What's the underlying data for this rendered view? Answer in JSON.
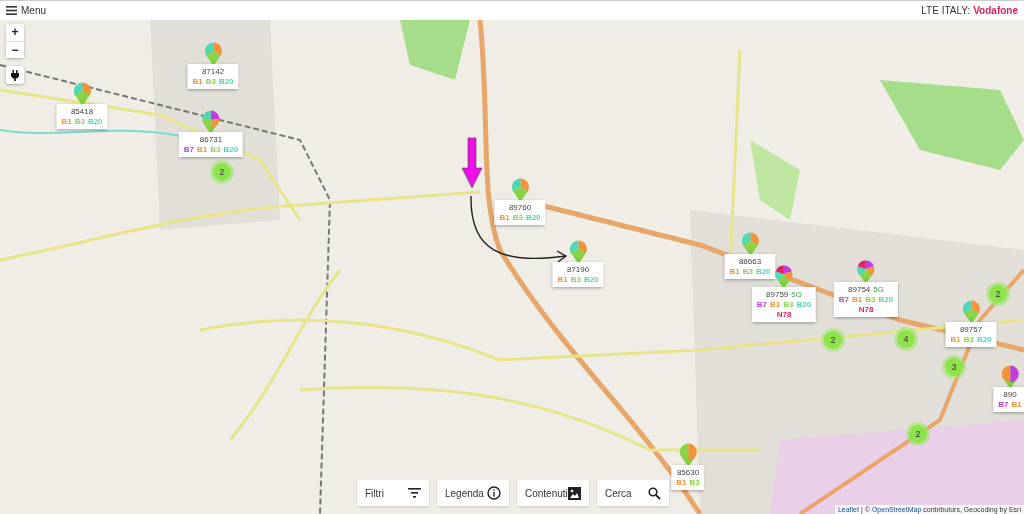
{
  "header": {
    "menu_label": "Menu",
    "title": "LTE ITALY:",
    "operator": "Vodafone"
  },
  "zoom_controls": [
    "+",
    "−"
  ],
  "markers": [
    {
      "id": "87142",
      "bands": [
        {
          "label": "B1",
          "color": "#f0943a"
        },
        {
          "label": "B3",
          "color": "#8bd44a"
        },
        {
          "label": "B20",
          "color": "#4fd8b4"
        }
      ]
    },
    {
      "id": "85418",
      "bands": [
        {
          "label": "B1",
          "color": "#f0943a"
        },
        {
          "label": "B3",
          "color": "#8bd44a"
        },
        {
          "label": "B20",
          "color": "#4fd8b4"
        }
      ]
    },
    {
      "id": "86731",
      "bands": [
        {
          "label": "B7",
          "color": "#c23de0"
        },
        {
          "label": "B1",
          "color": "#f0943a"
        },
        {
          "label": "B3",
          "color": "#8bd44a"
        },
        {
          "label": "B20",
          "color": "#4fd8b4"
        }
      ]
    },
    {
      "id": "89760",
      "bands": [
        {
          "label": "B1",
          "color": "#f0943a"
        },
        {
          "label": "B3",
          "color": "#8bd44a"
        },
        {
          "label": "B20",
          "color": "#4fd8b4"
        }
      ]
    },
    {
      "id": "87190",
      "bands": [
        {
          "label": "B1",
          "color": "#f0943a"
        },
        {
          "label": "B3",
          "color": "#8bd44a"
        },
        {
          "label": "B20",
          "color": "#4fd8b4"
        }
      ]
    },
    {
      "id": "88663",
      "bands": [
        {
          "label": "B1",
          "color": "#f0943a"
        },
        {
          "label": "B3",
          "color": "#8bd44a"
        },
        {
          "label": "B20",
          "color": "#4fd8b4"
        }
      ]
    },
    {
      "id": "89759",
      "tech": "5G",
      "bands": [
        {
          "label": "B7",
          "color": "#c23de0"
        },
        {
          "label": "B1",
          "color": "#f0943a"
        },
        {
          "label": "B3",
          "color": "#8bd44a"
        },
        {
          "label": "B20",
          "color": "#4fd8b4"
        }
      ],
      "bands_5g": [
        {
          "label": "N78",
          "color": "#e0245e"
        }
      ]
    },
    {
      "id": "89754",
      "tech": "5G",
      "bands": [
        {
          "label": "B7",
          "color": "#c23de0"
        },
        {
          "label": "B1",
          "color": "#f0943a"
        },
        {
          "label": "B3",
          "color": "#8bd44a"
        },
        {
          "label": "B20",
          "color": "#4fd8b4"
        }
      ],
      "bands_5g": [
        {
          "label": "N78",
          "color": "#e0245e"
        }
      ]
    },
    {
      "id": "89757",
      "bands": [
        {
          "label": "B1",
          "color": "#f0943a"
        },
        {
          "label": "B3",
          "color": "#8bd44a"
        },
        {
          "label": "B20",
          "color": "#4fd8b4"
        }
      ]
    },
    {
      "id": "890",
      "bands": [
        {
          "label": "B7",
          "color": "#c23de0"
        },
        {
          "label": "B1",
          "color": "#f0943a"
        }
      ]
    },
    {
      "id": "85630",
      "bands": [
        {
          "label": "B1",
          "color": "#f0943a"
        },
        {
          "label": "B3",
          "color": "#8bd44a"
        }
      ]
    }
  ],
  "clusters": [
    "2",
    "2",
    "4",
    "2",
    "3",
    "2"
  ],
  "toolbar": [
    {
      "label": "Filtri",
      "kind": "filter"
    },
    {
      "label": "Legenda",
      "kind": "info"
    },
    {
      "label": "Contenuti",
      "kind": "image"
    },
    {
      "label": "Cerca",
      "kind": "search"
    }
  ],
  "attribution": [
    {
      "text": "Leaflet",
      "kind": "link"
    },
    {
      "text": "|",
      "kind": "text"
    },
    {
      "text": "©",
      "kind": "text"
    },
    {
      "text": "OpenStreetMap",
      "kind": "link"
    },
    {
      "text": "contributors, Geocoding by Esri",
      "kind": "text"
    }
  ]
}
